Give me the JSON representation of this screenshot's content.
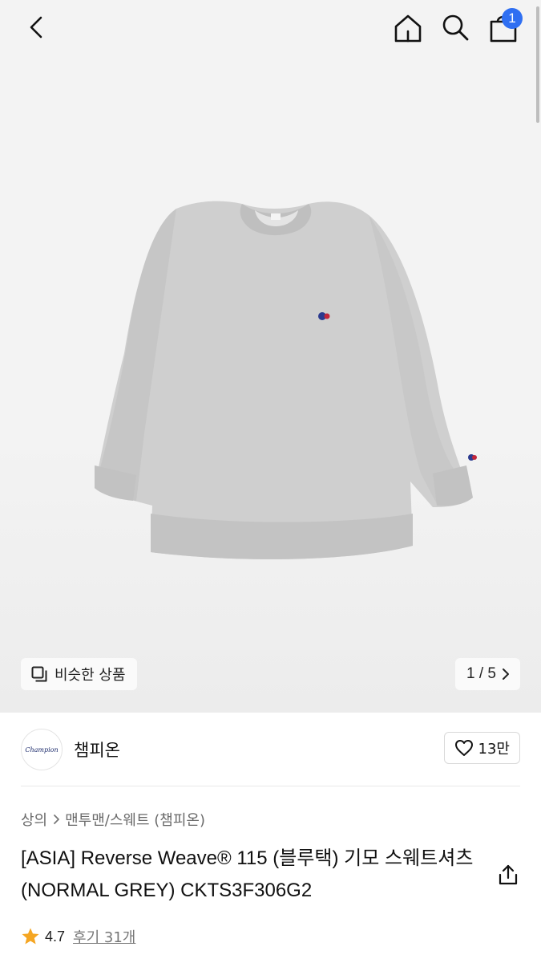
{
  "header": {
    "back_icon": "chevron-left-icon",
    "home_icon": "home-icon",
    "search_icon": "search-icon",
    "cart_icon": "shopping-bag-icon",
    "cart_count": "1",
    "badge_color": "#2f6ff2"
  },
  "gallery": {
    "similar_label": "비슷한 상품",
    "pager_label": "1 / 5",
    "image_alt": "grey crewneck sweatshirt"
  },
  "brand": {
    "name": "챔피온",
    "logo_text": "Champion",
    "like_count": "13만"
  },
  "breadcrumb": {
    "items": [
      "상의",
      "맨투맨/스웨트 (챔피온)"
    ]
  },
  "product": {
    "title": "[ASIA] Reverse Weave® 115 (블루택) 기모 스웨트셔츠 (NORMAL GREY) CKTS3F306G2",
    "rating": "4.7",
    "review_label": "후기 31개",
    "star_color": "#f5a623"
  }
}
